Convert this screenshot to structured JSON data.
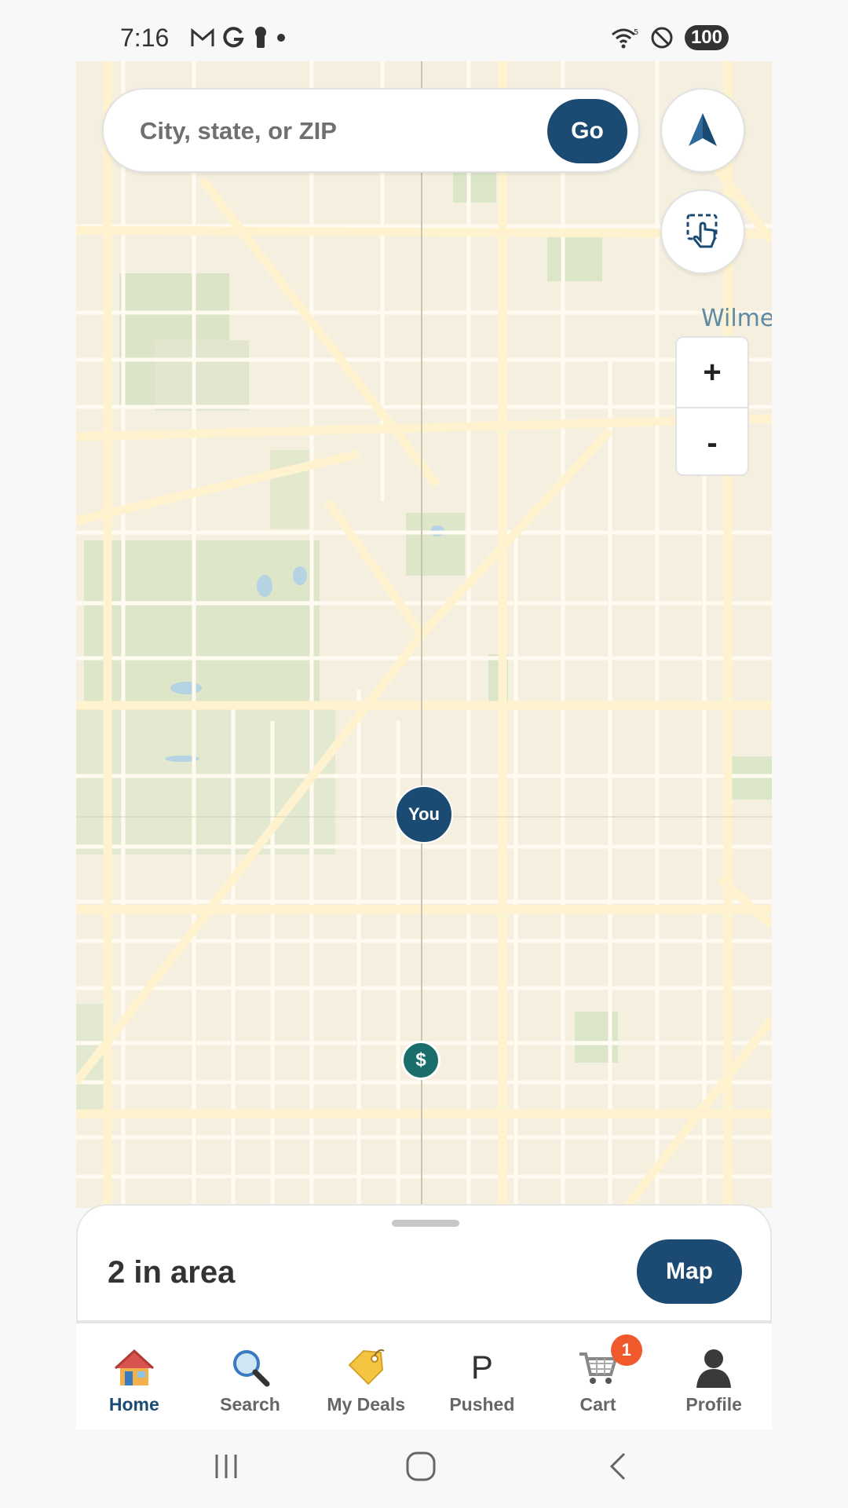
{
  "status_bar": {
    "time": "7:16",
    "icons_left": [
      "gmail-icon",
      "google-icon",
      "keyhole-icon",
      "dot-icon"
    ],
    "icons_right": [
      "wifi-icon",
      "do-not-disturb-icon"
    ],
    "battery": "100"
  },
  "search": {
    "placeholder": "City, state, or ZIP",
    "go_label": "Go"
  },
  "map": {
    "place_label": "Wilme",
    "zoom_in": "+",
    "zoom_out": "-",
    "you_pin_label": "You",
    "deal_pin_label": "$",
    "buttons": [
      "navigation-arrow-icon",
      "tap-select-icon"
    ]
  },
  "sheet": {
    "count_text": "2 in area",
    "map_button": "Map"
  },
  "tabs": [
    {
      "label": "Home",
      "icon": "house-icon",
      "active": true
    },
    {
      "label": "Search",
      "icon": "magnifier-icon"
    },
    {
      "label": "My Deals",
      "icon": "tag-icon"
    },
    {
      "label": "Pushed",
      "icon": "letter-p-icon",
      "glyph": "P"
    },
    {
      "label": "Cart",
      "icon": "cart-icon",
      "badge": "1"
    },
    {
      "label": "Profile",
      "icon": "person-icon"
    }
  ],
  "colors": {
    "brand": "#1b4a73",
    "deal_pin": "#1a6d6a",
    "badge": "#f0592b",
    "map_bg": "#f5efdf"
  }
}
